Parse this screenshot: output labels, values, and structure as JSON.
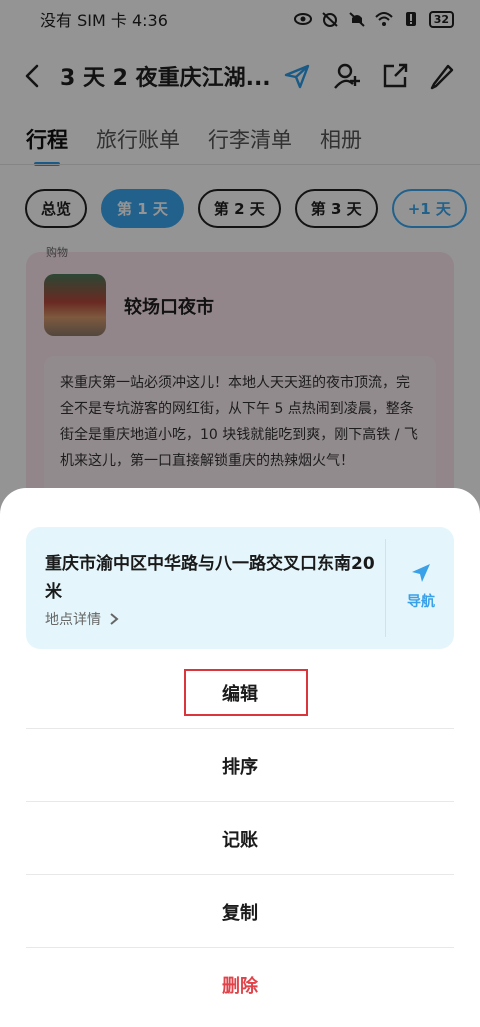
{
  "status_bar": {
    "carrier_time": "没有 SIM 卡 4:36",
    "battery": "32"
  },
  "header": {
    "title": "3 天 2 夜重庆江湖..."
  },
  "tabs": [
    {
      "label": "行程"
    },
    {
      "label": "旅行账单"
    },
    {
      "label": "行李清单"
    },
    {
      "label": "相册"
    }
  ],
  "day_chips": [
    {
      "label": "总览"
    },
    {
      "label": "第 1 天"
    },
    {
      "label": "第 2 天"
    },
    {
      "label": "第 3 天"
    },
    {
      "label": "+1 天"
    }
  ],
  "card": {
    "tag": "购物",
    "title": "较场口夜市",
    "description": "来重庆第一站必须冲这儿！本地人天天逛的夜市顶流，完全不是专坑游客的网红街，从下午 5 点热闹到凌晨，整条街全是重庆地道小吃，10 块钱就能吃到爽，刚下高铁 / 飞机来这儿，第一口直接解锁重庆的热辣烟火气！"
  },
  "sheet": {
    "address": "重庆市渝中区中华路与八一路交叉口东南20米",
    "detail_label": "地点详情",
    "nav_label": "导航",
    "actions": [
      {
        "label": "编辑"
      },
      {
        "label": "排序"
      },
      {
        "label": "记账"
      },
      {
        "label": "复制"
      },
      {
        "label": "删除"
      }
    ]
  },
  "colors": {
    "accent": "#3aa7f0",
    "delete": "#e0444a",
    "highlight_border": "#d8363c"
  }
}
